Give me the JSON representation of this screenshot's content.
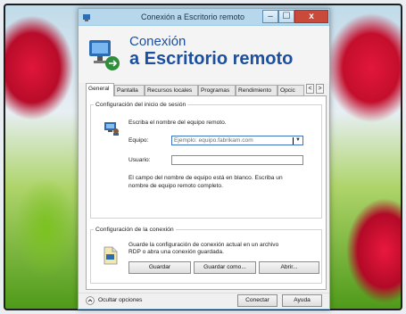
{
  "window": {
    "title": "Conexión a Escritorio remoto",
    "controls": {
      "minimize": "–",
      "maximize": "☐",
      "close": "x"
    }
  },
  "header": {
    "line1": "Conexión",
    "line2": "a Escritorio remoto"
  },
  "tabs": [
    {
      "label": "General",
      "active": true
    },
    {
      "label": "Pantalla"
    },
    {
      "label": "Recursos locales"
    },
    {
      "label": "Programas"
    },
    {
      "label": "Rendimiento"
    },
    {
      "label": "Opcic"
    }
  ],
  "tab_scroll": {
    "left": "<",
    "right": ">"
  },
  "login": {
    "legend": "Configuración del inicio de sesión",
    "instruction": "Escriba el nombre del equipo remoto.",
    "equipo_label": "Equipo:",
    "equipo_value": "Ejemplo: equipo.fabrikam.com",
    "usuario_label": "Usuario:",
    "usuario_value": "",
    "note_line1": "El campo del nombre de equipo está en blanco. Escriba un",
    "note_line2": "nombre de equipo remoto completo."
  },
  "connection": {
    "legend": "Configuración de la conexión",
    "desc_line1": "Guarde la configuración de conexión actual en un archivo",
    "desc_line2": "RDP o abra una conexión guardada.",
    "buttons": {
      "save": "Guardar",
      "save_as": "Guardar como...",
      "open": "Abrir..."
    }
  },
  "footer": {
    "hide_options": "Ocultar opciones",
    "connect": "Conectar",
    "help": "Ayuda"
  }
}
